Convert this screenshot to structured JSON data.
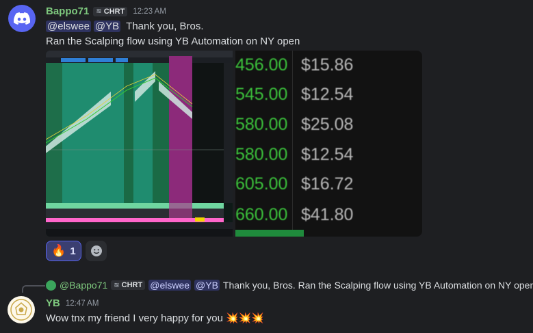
{
  "message1": {
    "author": "Bappo71",
    "tag": "CHRT",
    "time": "12:23 AM",
    "mention1": "@elswee",
    "mention2": "@YB",
    "line1_text": "Thank you, Bros.",
    "line2_text": "Ran the Scalping flow using YB Automation on NY open",
    "attachment2_prices": [
      {
        "strike": "456.00",
        "price": "$15.86"
      },
      {
        "strike": "545.00",
        "price": "$12.54"
      },
      {
        "strike": "580.00",
        "price": "$25.08"
      },
      {
        "strike": "580.00",
        "price": "$12.54"
      },
      {
        "strike": "605.00",
        "price": "$16.72"
      },
      {
        "strike": "660.00",
        "price": "$41.80"
      }
    ],
    "reactions": [
      {
        "emoji": "🔥",
        "count": "1"
      },
      {
        "emoji": "add-reaction-icon"
      }
    ]
  },
  "reply_preview": {
    "author": "@Bappo71",
    "tag": "CHRT",
    "mention1": "@elswee",
    "mention2": "@YB",
    "text": "Thank you, Bros.  Ran the Scalping flow using YB Automation on NY open"
  },
  "message2": {
    "author": "YB",
    "time": "12:47 AM",
    "text": "Wow tnx my friend I very happy for you",
    "emojis": "💥💥💥"
  },
  "colors": {
    "author1": "#7ec87e",
    "author2": "#7ec87e",
    "accent": "#5865f2"
  }
}
